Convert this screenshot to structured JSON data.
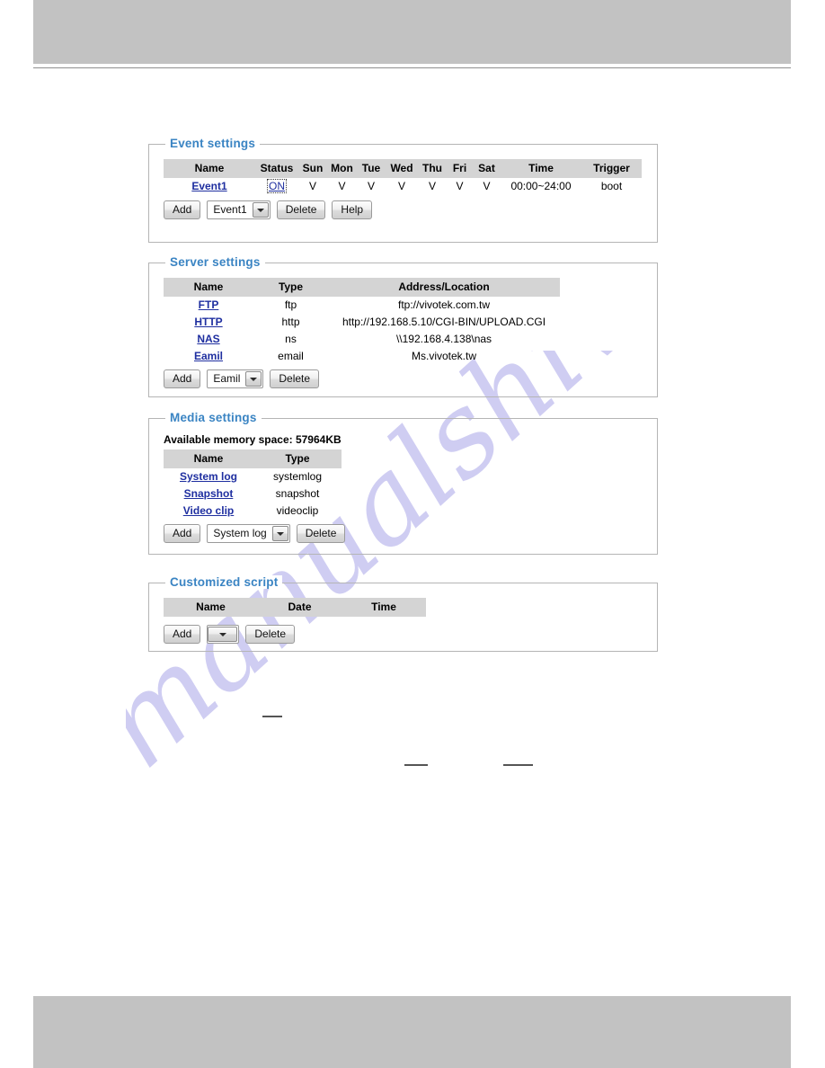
{
  "page": {
    "watermark_text": "manualshive.com",
    "accent_color": "#3a84c3",
    "link_color": "#1f2fa0",
    "header_band_color": "#c2c2c2"
  },
  "event_settings": {
    "legend": "Event settings",
    "columns": [
      "Name",
      "Status",
      "Sun",
      "Mon",
      "Tue",
      "Wed",
      "Thu",
      "Fri",
      "Sat",
      "Time",
      "Trigger"
    ],
    "rows": [
      {
        "name": "Event1",
        "status": "ON",
        "sun": "V",
        "mon": "V",
        "tue": "V",
        "wed": "V",
        "thu": "V",
        "fri": "V",
        "sat": "V",
        "time": "00:00~24:00",
        "trigger": "boot"
      }
    ],
    "controls": {
      "add_label": "Add",
      "select_value": "Event1",
      "delete_label": "Delete",
      "help_label": "Help"
    }
  },
  "server_settings": {
    "legend": "Server settings",
    "columns": [
      "Name",
      "Type",
      "Address/Location"
    ],
    "rows": [
      {
        "name": "FTP",
        "type": "ftp",
        "address": "ftp://vivotek.com.tw"
      },
      {
        "name": "HTTP",
        "type": "http",
        "address": "http://192.168.5.10/CGI-BIN/UPLOAD.CGI"
      },
      {
        "name": "NAS",
        "type": "ns",
        "address": "\\\\192.168.4.138\\nas"
      },
      {
        "name": "Eamil",
        "type": "email",
        "address": "Ms.vivotek.tw"
      }
    ],
    "controls": {
      "add_label": "Add",
      "select_value": "Eamil",
      "delete_label": "Delete"
    }
  },
  "media_settings": {
    "legend": "Media settings",
    "memory_note": "Available memory space: 57964KB",
    "columns": [
      "Name",
      "Type"
    ],
    "rows": [
      {
        "name": "System log",
        "type": "systemlog"
      },
      {
        "name": "Snapshot",
        "type": "snapshot"
      },
      {
        "name": "Video clip",
        "type": "videoclip"
      }
    ],
    "controls": {
      "add_label": "Add",
      "select_value": "System log",
      "delete_label": "Delete"
    }
  },
  "customized_script": {
    "legend": "Customized script",
    "columns": [
      "Name",
      "Date",
      "Time"
    ],
    "rows": [],
    "controls": {
      "add_label": "Add",
      "select_value": "",
      "delete_label": "Delete"
    }
  }
}
